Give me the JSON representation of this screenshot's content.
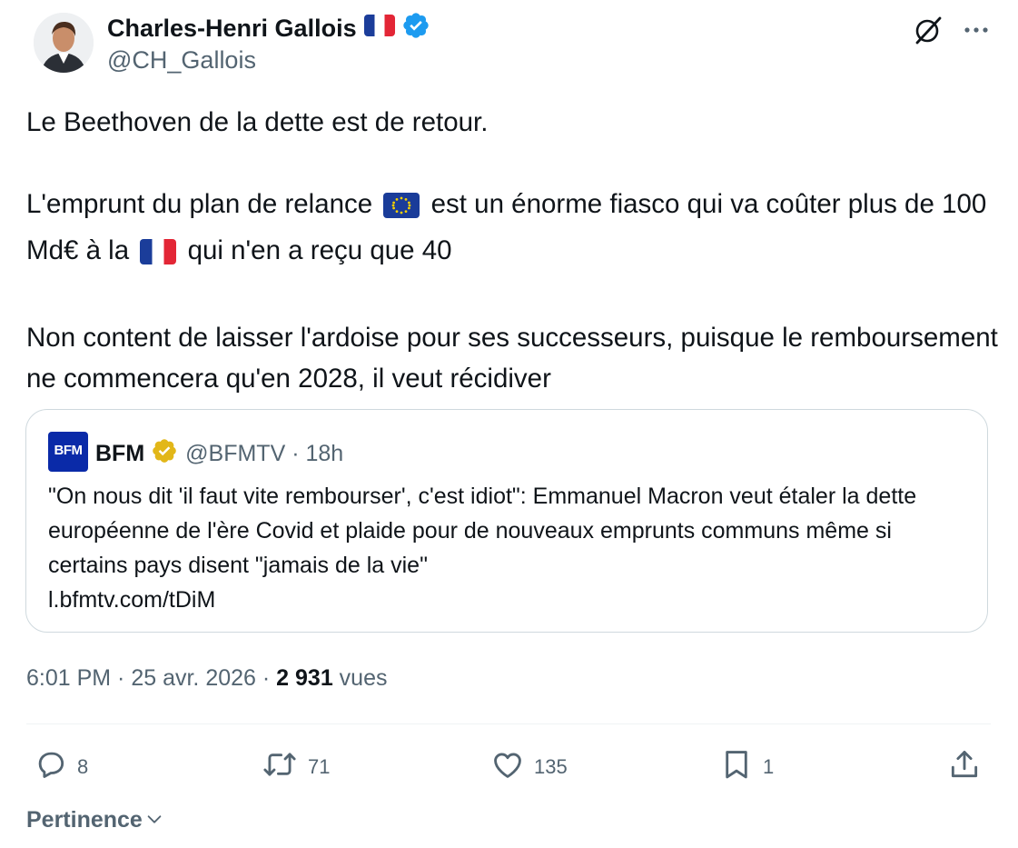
{
  "author": {
    "name": "Charles-Henri Gallois",
    "handle": "@CH_Gallois"
  },
  "tweet": {
    "line1": "Le Beethoven de la dette est de retour.",
    "p2_a": "L'emprunt du plan de relance",
    "p2_b": "est un énorme fiasco qui va coûter plus de 100 Md€ à la",
    "p2_c": "qui n'en a reçu que 40",
    "p3": "Non content de laisser l'ardoise pour ses successeurs, puisque le remboursement ne commencera qu'en 2028, il veut récidiver"
  },
  "quote": {
    "logo_text": "BFM",
    "name": "BFM",
    "handle_time": "@BFMTV · 18h",
    "text": "\"On nous dit 'il faut vite rembourser', c'est idiot\": Emmanuel Macron veut étaler la dette européenne de l'ère Covid et plaide pour de nouveaux emprunts communs même si certains pays disent \"jamais de la vie\"",
    "link": "l.bfmtv.com/tDiM"
  },
  "meta": {
    "time_date": "6:01 PM · 25 avr. 2026 · ",
    "views_count": "2 931",
    "views_label": " vues"
  },
  "actions": {
    "replies": "8",
    "reposts": "71",
    "likes": "135",
    "bookmarks": "1"
  },
  "sort_label": "Pertinence",
  "colors": {
    "text_primary": "#0f1419",
    "text_secondary": "#536471",
    "verified_blue": "#1d9bf0",
    "verified_gold": "#e2b719",
    "border": "#cfd9de",
    "bfm_blue": "#0a2aa8"
  },
  "icons": [
    "verified-badge-icon",
    "grok-icon",
    "more-icon",
    "reply-icon",
    "repost-icon",
    "like-icon",
    "bookmark-icon",
    "share-icon",
    "chevron-down-icon"
  ]
}
